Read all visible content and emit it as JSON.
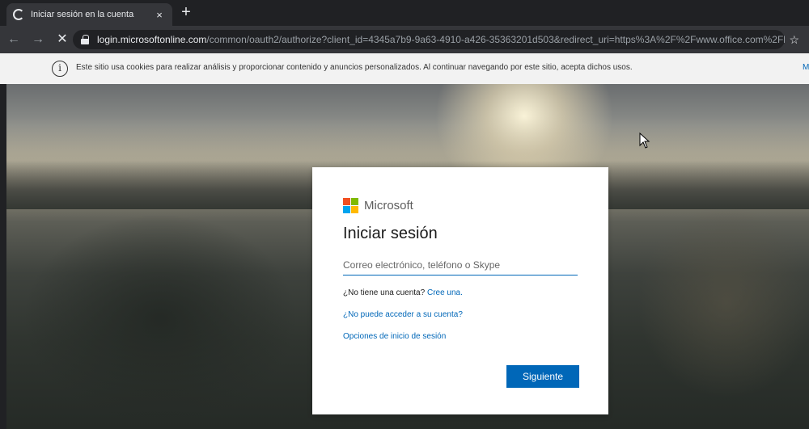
{
  "browser": {
    "tab": {
      "title": "Iniciar sesión en la cuenta",
      "close": "×",
      "icon": "loading-spinner"
    },
    "new_tab": "+",
    "nav": {
      "back": "←",
      "forward": "→",
      "stop": "✕"
    },
    "address": {
      "host": "login.microsoftonline.com",
      "path": "/common/oauth2/authorize?client_id=4345a7b9-9a63-4910-a426-35363201d503&redirect_uri=https%3A%2F%2Fwww.office.com%2Fla..."
    },
    "bookmark_star": "☆"
  },
  "cookie_banner": {
    "icon": "i",
    "text": "Este sitio usa cookies para realizar análisis y proporcionar contenido y anuncios personalizados. Al continuar navegando por este sitio, acepta dichos usos.",
    "more": "M"
  },
  "signin": {
    "brand": "Microsoft",
    "brand_colors": [
      "#f25022",
      "#7fba00",
      "#00a4ef",
      "#ffb900"
    ],
    "title": "Iniciar sesión",
    "email_placeholder": "Correo electrónico, teléfono o Skype",
    "no_account_text": "¿No tiene una cuenta?",
    "create_link": "Cree una.",
    "cant_access_link": "¿No puede acceder a su cuenta?",
    "signin_options_link": "Opciones de inicio de sesión",
    "next_button": "Siguiente"
  },
  "colors": {
    "accent": "#0067b8"
  }
}
